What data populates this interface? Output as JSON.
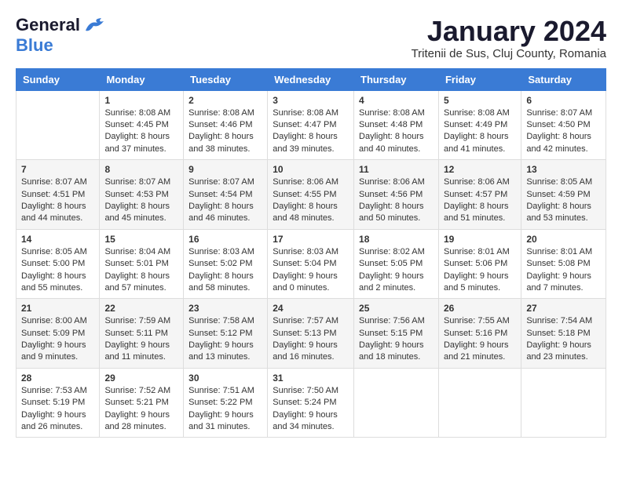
{
  "logo": {
    "line1": "General",
    "line2": "Blue"
  },
  "title": "January 2024",
  "subtitle": "Tritenii de Sus, Cluj County, Romania",
  "days_of_week": [
    "Sunday",
    "Monday",
    "Tuesday",
    "Wednesday",
    "Thursday",
    "Friday",
    "Saturday"
  ],
  "weeks": [
    [
      {
        "day": "",
        "lines": []
      },
      {
        "day": "1",
        "lines": [
          "Sunrise: 8:08 AM",
          "Sunset: 4:45 PM",
          "Daylight: 8 hours",
          "and 37 minutes."
        ]
      },
      {
        "day": "2",
        "lines": [
          "Sunrise: 8:08 AM",
          "Sunset: 4:46 PM",
          "Daylight: 8 hours",
          "and 38 minutes."
        ]
      },
      {
        "day": "3",
        "lines": [
          "Sunrise: 8:08 AM",
          "Sunset: 4:47 PM",
          "Daylight: 8 hours",
          "and 39 minutes."
        ]
      },
      {
        "day": "4",
        "lines": [
          "Sunrise: 8:08 AM",
          "Sunset: 4:48 PM",
          "Daylight: 8 hours",
          "and 40 minutes."
        ]
      },
      {
        "day": "5",
        "lines": [
          "Sunrise: 8:08 AM",
          "Sunset: 4:49 PM",
          "Daylight: 8 hours",
          "and 41 minutes."
        ]
      },
      {
        "day": "6",
        "lines": [
          "Sunrise: 8:07 AM",
          "Sunset: 4:50 PM",
          "Daylight: 8 hours",
          "and 42 minutes."
        ]
      }
    ],
    [
      {
        "day": "7",
        "lines": [
          "Sunrise: 8:07 AM",
          "Sunset: 4:51 PM",
          "Daylight: 8 hours",
          "and 44 minutes."
        ]
      },
      {
        "day": "8",
        "lines": [
          "Sunrise: 8:07 AM",
          "Sunset: 4:53 PM",
          "Daylight: 8 hours",
          "and 45 minutes."
        ]
      },
      {
        "day": "9",
        "lines": [
          "Sunrise: 8:07 AM",
          "Sunset: 4:54 PM",
          "Daylight: 8 hours",
          "and 46 minutes."
        ]
      },
      {
        "day": "10",
        "lines": [
          "Sunrise: 8:06 AM",
          "Sunset: 4:55 PM",
          "Daylight: 8 hours",
          "and 48 minutes."
        ]
      },
      {
        "day": "11",
        "lines": [
          "Sunrise: 8:06 AM",
          "Sunset: 4:56 PM",
          "Daylight: 8 hours",
          "and 50 minutes."
        ]
      },
      {
        "day": "12",
        "lines": [
          "Sunrise: 8:06 AM",
          "Sunset: 4:57 PM",
          "Daylight: 8 hours",
          "and 51 minutes."
        ]
      },
      {
        "day": "13",
        "lines": [
          "Sunrise: 8:05 AM",
          "Sunset: 4:59 PM",
          "Daylight: 8 hours",
          "and 53 minutes."
        ]
      }
    ],
    [
      {
        "day": "14",
        "lines": [
          "Sunrise: 8:05 AM",
          "Sunset: 5:00 PM",
          "Daylight: 8 hours",
          "and 55 minutes."
        ]
      },
      {
        "day": "15",
        "lines": [
          "Sunrise: 8:04 AM",
          "Sunset: 5:01 PM",
          "Daylight: 8 hours",
          "and 57 minutes."
        ]
      },
      {
        "day": "16",
        "lines": [
          "Sunrise: 8:03 AM",
          "Sunset: 5:02 PM",
          "Daylight: 8 hours",
          "and 58 minutes."
        ]
      },
      {
        "day": "17",
        "lines": [
          "Sunrise: 8:03 AM",
          "Sunset: 5:04 PM",
          "Daylight: 9 hours",
          "and 0 minutes."
        ]
      },
      {
        "day": "18",
        "lines": [
          "Sunrise: 8:02 AM",
          "Sunset: 5:05 PM",
          "Daylight: 9 hours",
          "and 2 minutes."
        ]
      },
      {
        "day": "19",
        "lines": [
          "Sunrise: 8:01 AM",
          "Sunset: 5:06 PM",
          "Daylight: 9 hours",
          "and 5 minutes."
        ]
      },
      {
        "day": "20",
        "lines": [
          "Sunrise: 8:01 AM",
          "Sunset: 5:08 PM",
          "Daylight: 9 hours",
          "and 7 minutes."
        ]
      }
    ],
    [
      {
        "day": "21",
        "lines": [
          "Sunrise: 8:00 AM",
          "Sunset: 5:09 PM",
          "Daylight: 9 hours",
          "and 9 minutes."
        ]
      },
      {
        "day": "22",
        "lines": [
          "Sunrise: 7:59 AM",
          "Sunset: 5:11 PM",
          "Daylight: 9 hours",
          "and 11 minutes."
        ]
      },
      {
        "day": "23",
        "lines": [
          "Sunrise: 7:58 AM",
          "Sunset: 5:12 PM",
          "Daylight: 9 hours",
          "and 13 minutes."
        ]
      },
      {
        "day": "24",
        "lines": [
          "Sunrise: 7:57 AM",
          "Sunset: 5:13 PM",
          "Daylight: 9 hours",
          "and 16 minutes."
        ]
      },
      {
        "day": "25",
        "lines": [
          "Sunrise: 7:56 AM",
          "Sunset: 5:15 PM",
          "Daylight: 9 hours",
          "and 18 minutes."
        ]
      },
      {
        "day": "26",
        "lines": [
          "Sunrise: 7:55 AM",
          "Sunset: 5:16 PM",
          "Daylight: 9 hours",
          "and 21 minutes."
        ]
      },
      {
        "day": "27",
        "lines": [
          "Sunrise: 7:54 AM",
          "Sunset: 5:18 PM",
          "Daylight: 9 hours",
          "and 23 minutes."
        ]
      }
    ],
    [
      {
        "day": "28",
        "lines": [
          "Sunrise: 7:53 AM",
          "Sunset: 5:19 PM",
          "Daylight: 9 hours",
          "and 26 minutes."
        ]
      },
      {
        "day": "29",
        "lines": [
          "Sunrise: 7:52 AM",
          "Sunset: 5:21 PM",
          "Daylight: 9 hours",
          "and 28 minutes."
        ]
      },
      {
        "day": "30",
        "lines": [
          "Sunrise: 7:51 AM",
          "Sunset: 5:22 PM",
          "Daylight: 9 hours",
          "and 31 minutes."
        ]
      },
      {
        "day": "31",
        "lines": [
          "Sunrise: 7:50 AM",
          "Sunset: 5:24 PM",
          "Daylight: 9 hours",
          "and 34 minutes."
        ]
      },
      {
        "day": "",
        "lines": []
      },
      {
        "day": "",
        "lines": []
      },
      {
        "day": "",
        "lines": []
      }
    ]
  ]
}
